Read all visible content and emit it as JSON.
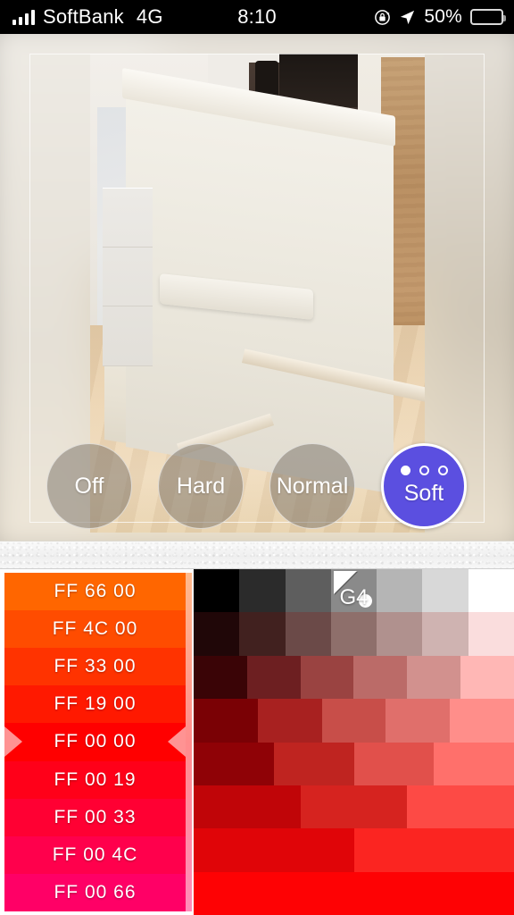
{
  "statusbar": {
    "carrier": "SoftBank",
    "network": "4G",
    "time": "8:10",
    "battery_percent": "50%",
    "battery_level": 50,
    "icons": [
      "signal-bars-icon",
      "rotation-lock-icon",
      "location-arrow-icon",
      "battery-icon"
    ]
  },
  "preview": {
    "label": "photo-preview"
  },
  "modes": {
    "items": [
      {
        "label": "Off",
        "selected": false,
        "dots": 0
      },
      {
        "label": "Hard",
        "selected": false,
        "dots": 0
      },
      {
        "label": "Normal",
        "selected": false,
        "dots": 0
      },
      {
        "label": "Soft",
        "selected": true,
        "dots": 3,
        "dots_filled": 1
      }
    ],
    "selected_color": "#5B4FE0"
  },
  "picker": {
    "selected_swatch": "FF 00 00",
    "selected_grid_cell": "G4",
    "swatches": [
      {
        "label": "FF 66 00",
        "color": "#FF6600",
        "selected": false
      },
      {
        "label": "FF 4C 00",
        "color": "#FF4C00",
        "selected": false
      },
      {
        "label": "FF 33 00",
        "color": "#FF3300",
        "selected": false
      },
      {
        "label": "FF 19 00",
        "color": "#FF1900",
        "selected": false
      },
      {
        "label": "FF 00 00",
        "color": "#FF0000",
        "selected": true
      },
      {
        "label": "FF 00 19",
        "color": "#FF0019",
        "selected": false
      },
      {
        "label": "FF 00 33",
        "color": "#FF0033",
        "selected": false
      },
      {
        "label": "FF 00 4C",
        "color": "#FF004C",
        "selected": false
      },
      {
        "label": "FF 00 66",
        "color": "#FF0066",
        "selected": false
      }
    ],
    "grid": {
      "rows": [
        {
          "cells": [
            "#000000",
            "#2b2b2b",
            "#5e5e5e",
            "#8a8a8a",
            "#b5b5b5",
            "#d8d8d8",
            "#ffffff"
          ],
          "active_index": 3,
          "active_label": "G4"
        },
        {
          "cells": [
            "#200708",
            "#41211f",
            "#6b4a48",
            "#8e6f6b",
            "#b0918e",
            "#cfb3b1",
            "#fadddd"
          ],
          "active_index": -1
        },
        {
          "cells": [
            "#3a0406",
            "#6d1f21",
            "#9a4341",
            "#bb6b68",
            "#d2918e",
            "#ffb7b5"
          ],
          "active_index": -1
        },
        {
          "cells": [
            "#7a0105",
            "#a82120",
            "#c84e49",
            "#e06f6b",
            "#ff8e8a"
          ],
          "active_index": -1
        },
        {
          "cells": [
            "#8f0206",
            "#bf2420",
            "#e1504b",
            "#ff706b"
          ],
          "active_index": -1
        },
        {
          "cells": [
            "#c00508",
            "#d6231f",
            "#fd4a45"
          ],
          "active_index": -1
        },
        {
          "cells": [
            "#e00508",
            "#fb2521"
          ],
          "active_index": -1
        },
        {
          "cells": [
            "#fe0204"
          ],
          "active_index": -1
        }
      ]
    }
  }
}
